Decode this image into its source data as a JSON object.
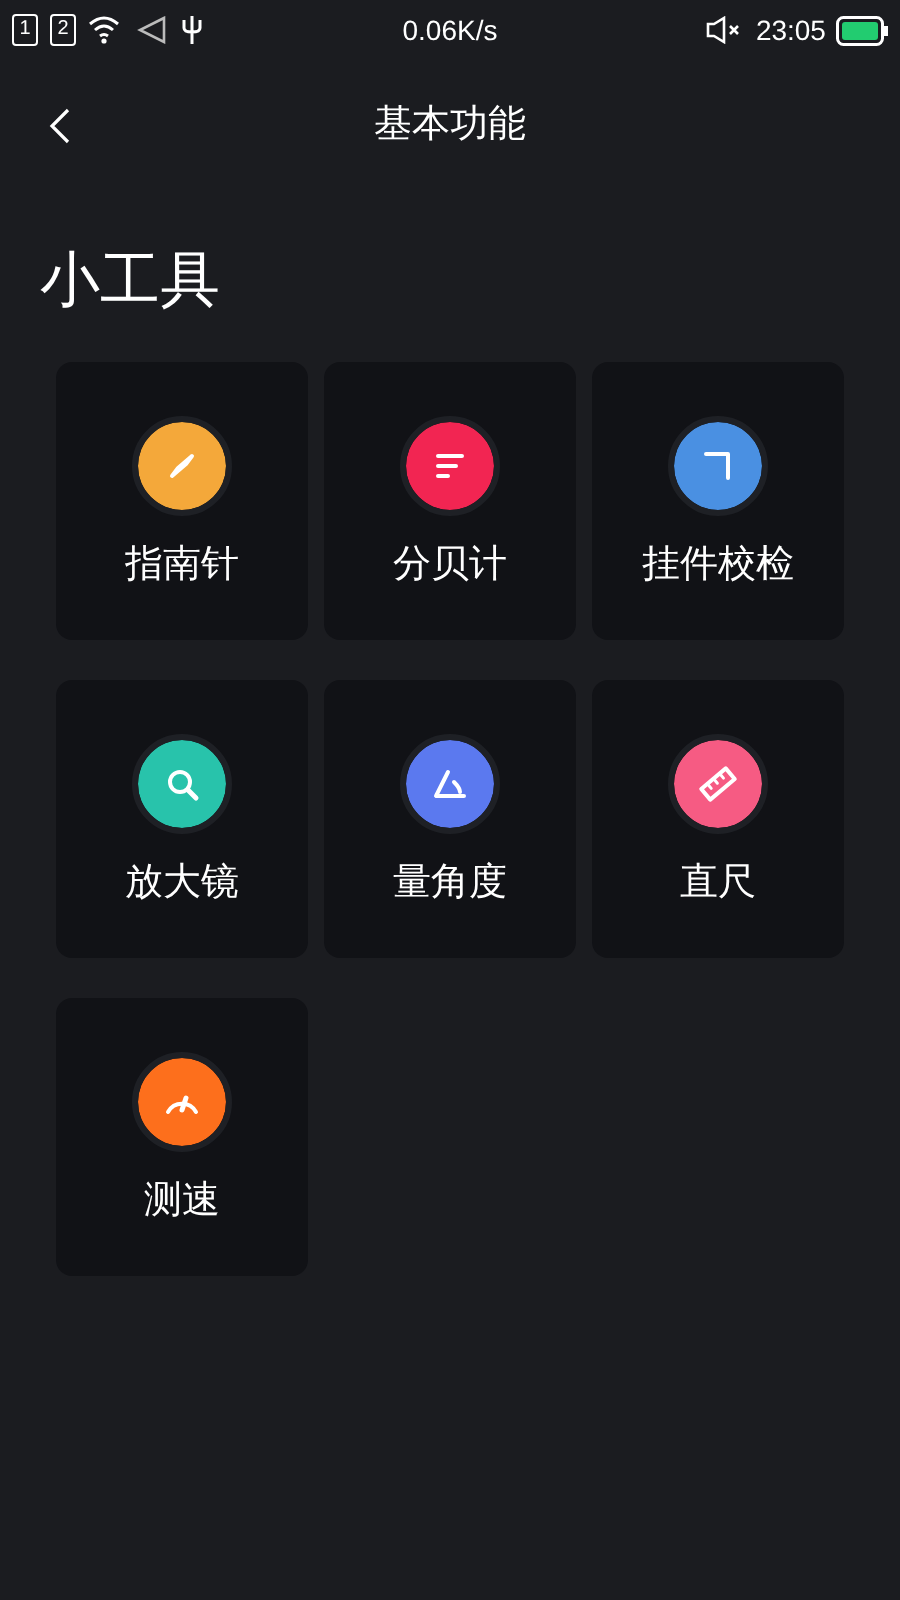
{
  "status_bar": {
    "sims": [
      "1",
      "2"
    ],
    "speed": "0.06K/s",
    "time": "23:05"
  },
  "header": {
    "title": "基本功能"
  },
  "section": {
    "title": "小工具"
  },
  "tools": [
    {
      "label": "指南针",
      "kind": "compass",
      "color": "#f4a83a"
    },
    {
      "label": "分贝计",
      "kind": "decibel",
      "color": "#f22552"
    },
    {
      "label": "挂件校检",
      "kind": "level",
      "color": "#4a90e2"
    },
    {
      "label": "放大镜",
      "kind": "magnifier",
      "color": "#28c3ab"
    },
    {
      "label": "量角度",
      "kind": "angle",
      "color": "#5b79ef"
    },
    {
      "label": "直尺",
      "kind": "ruler",
      "color": "#f65b83"
    },
    {
      "label": "测速",
      "kind": "speed",
      "color": "#fd6f1c"
    }
  ]
}
